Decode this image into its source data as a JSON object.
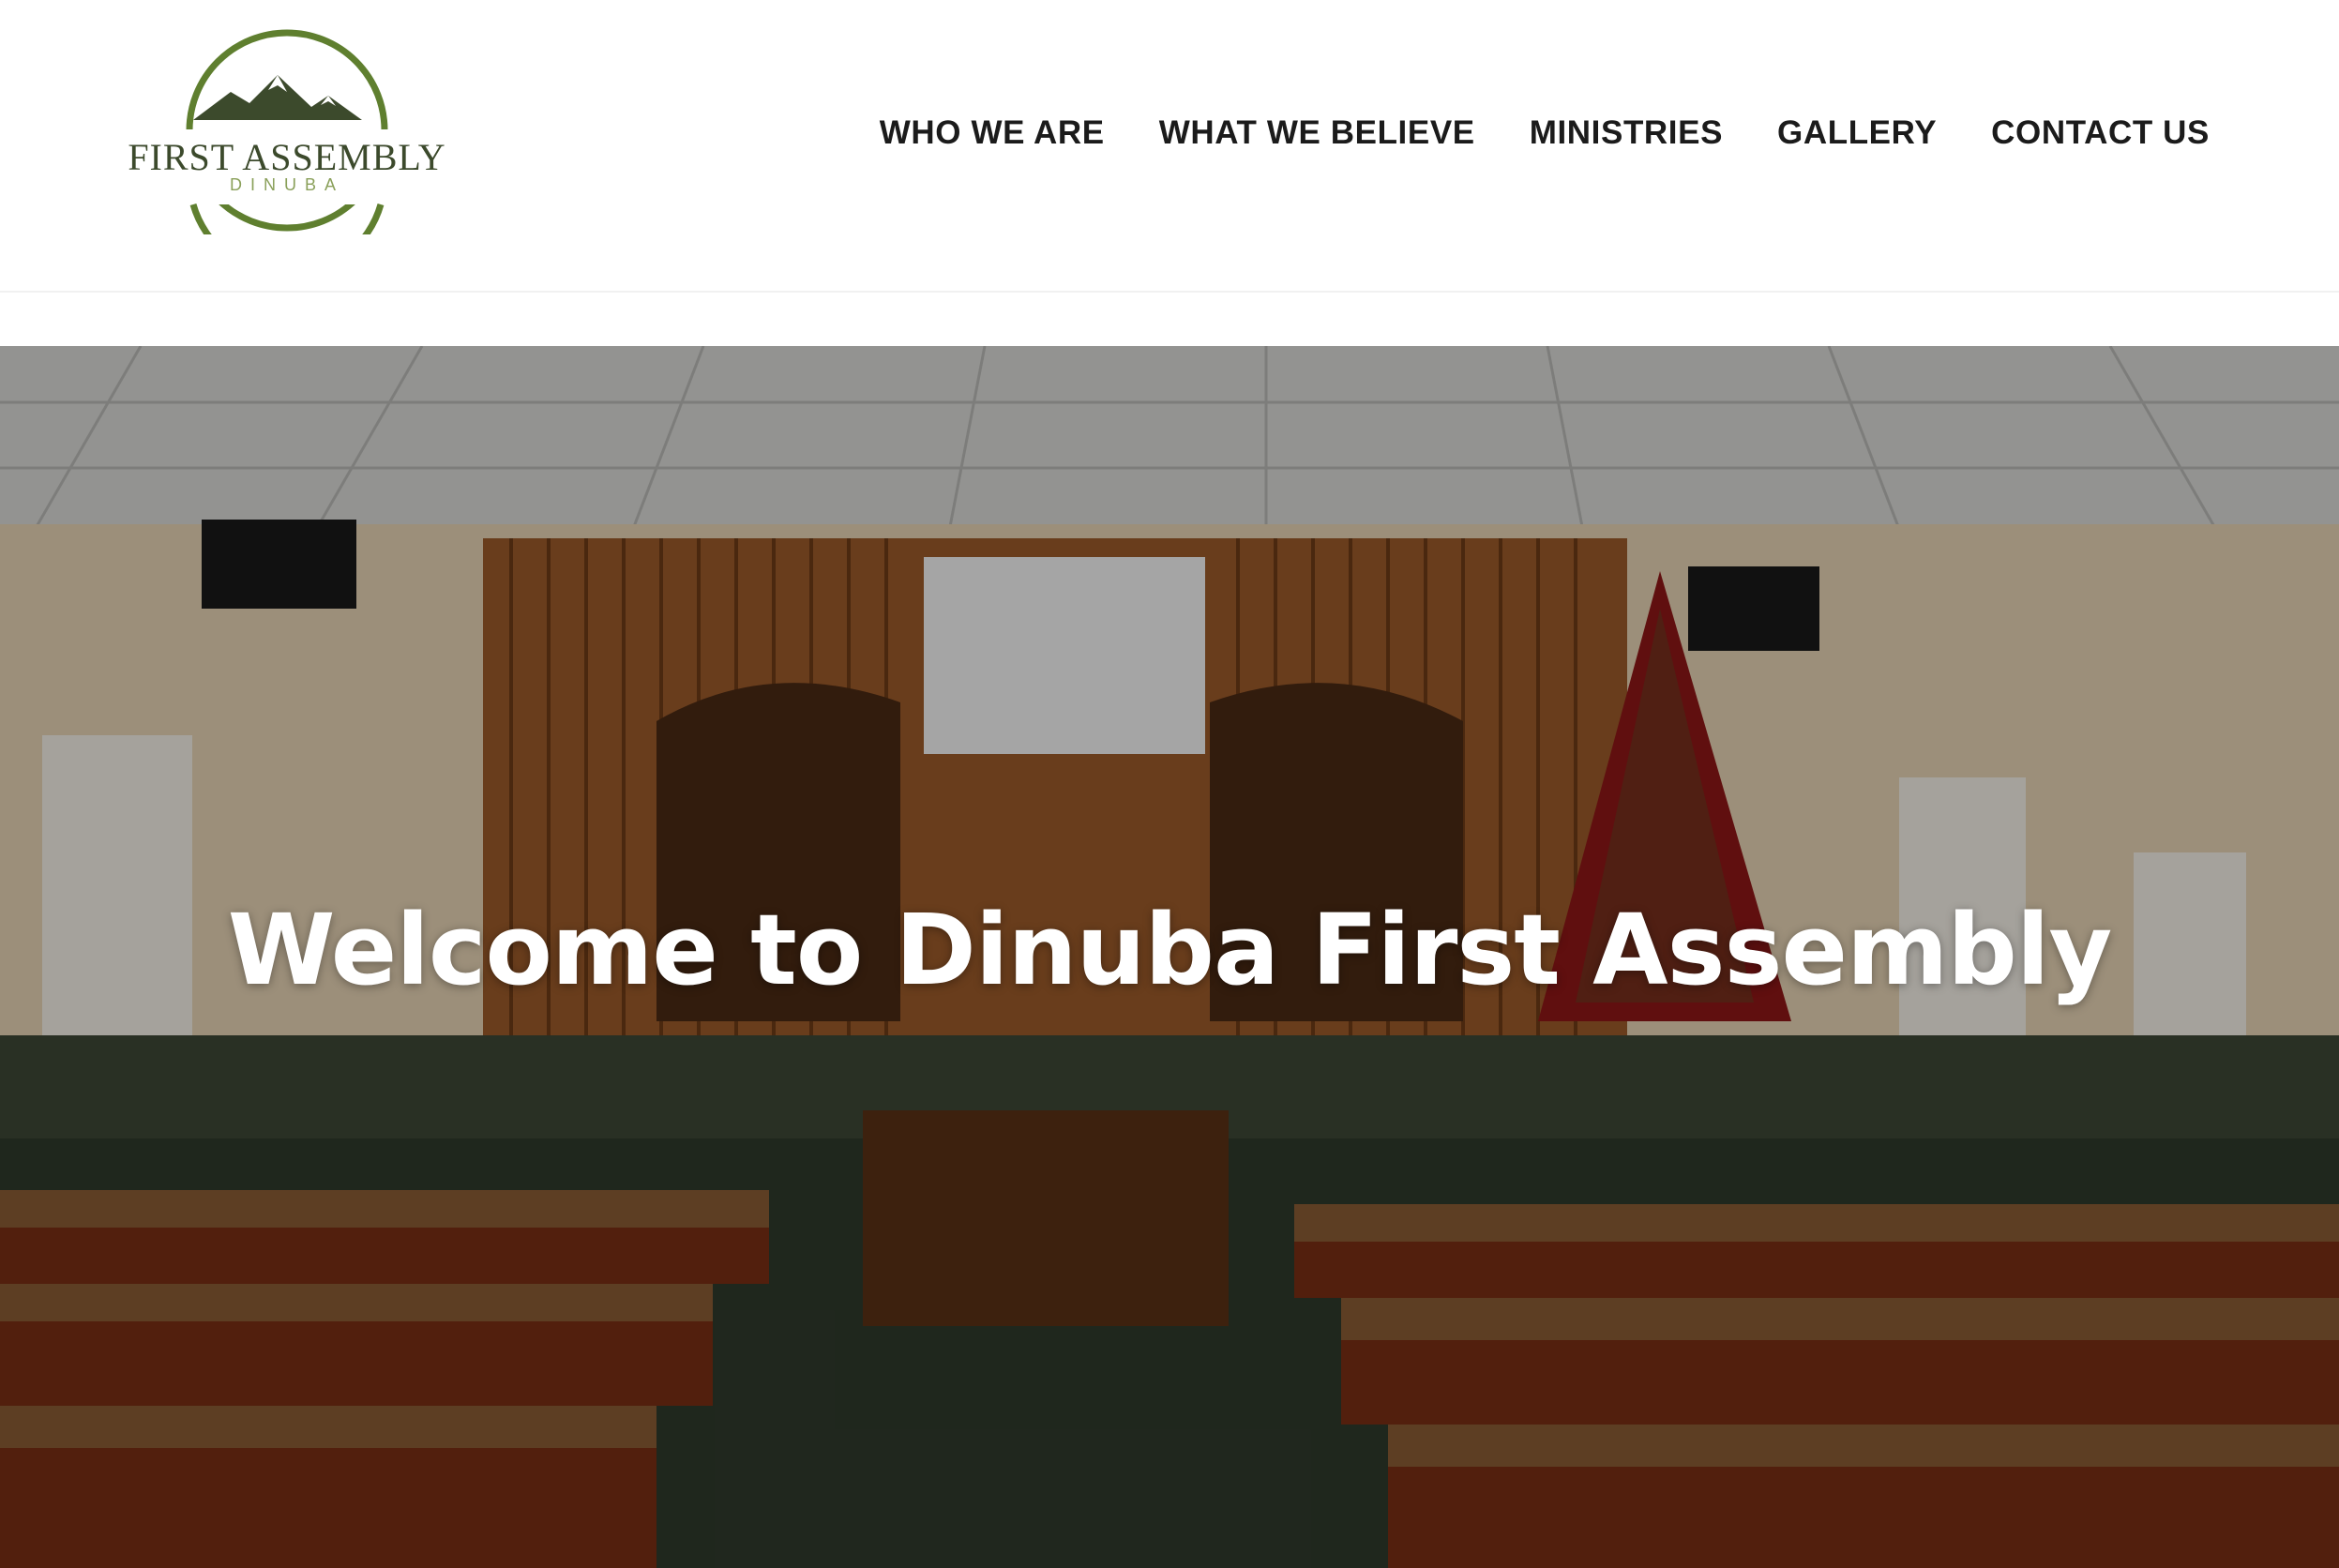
{
  "brand": {
    "name": "FIRST ASSEMBLY",
    "location": "DINUBA",
    "accent_color": "#5f7f2f",
    "mountain_color": "#3c4a2c"
  },
  "nav": {
    "items": [
      {
        "label": "WHO WE ARE"
      },
      {
        "label": "WHAT WE BELIEVE"
      },
      {
        "label": "MINISTRIES"
      },
      {
        "label": "GALLERY"
      },
      {
        "label": "CONTACT US"
      }
    ]
  },
  "hero": {
    "title": "Welcome to Dinuba First Assembly",
    "image_subject": "church sanctuary interior with pews, stage, projector screen and decorated Christmas tree"
  }
}
